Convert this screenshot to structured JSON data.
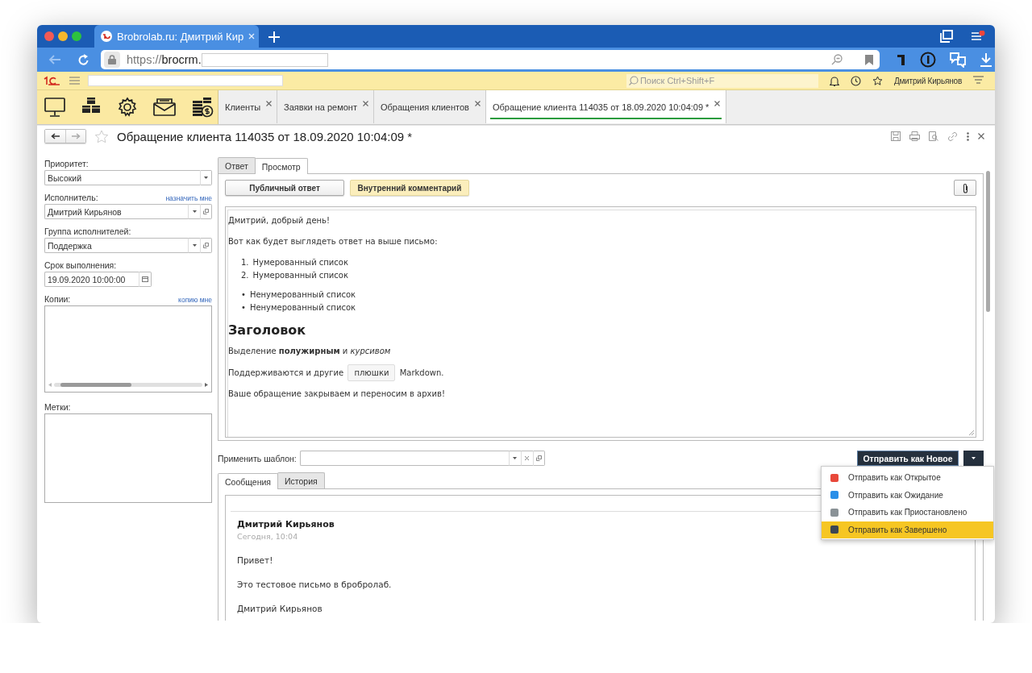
{
  "browser": {
    "tab_title": "Brobrolab.ru: Дмитрий Кир",
    "url_scheme": "https://",
    "url_host": "brocrm."
  },
  "app_header": {
    "search_placeholder": "Поиск Ctrl+Shift+F",
    "user_name": "Дмитрий Кирьянов"
  },
  "open_tabs": [
    {
      "label": "Клиенты",
      "selected": false
    },
    {
      "label": "Заявки на ремонт",
      "selected": false
    },
    {
      "label": "Обращения клиентов",
      "selected": false
    },
    {
      "label": "Обращение клиента 114035 от 18.09.2020 10:04:09 *",
      "selected": true
    }
  ],
  "form": {
    "title": "Обращение клиента 114035 от 18.09.2020 10:04:09 *"
  },
  "fields": [
    {
      "kind": "select",
      "label": "Приоритет:",
      "value": "Высокий"
    },
    {
      "kind": "reference",
      "label": "Исполнитель:",
      "link": "назначить мне",
      "value": "Дмитрий Кирьянов"
    },
    {
      "kind": "reference",
      "label": "Группа исполнителей:",
      "value": "Поддержка"
    },
    {
      "kind": "date",
      "label": "Срок выполнения:",
      "value": "19.09.2020 10:00:00"
    },
    {
      "kind": "list",
      "label": "Копии:",
      "link": "копию мне",
      "horizontal_scrollbar": true
    },
    {
      "kind": "list",
      "label": "Метки:",
      "horizontal_scrollbar": false
    }
  ],
  "editor_tabs": [
    {
      "label": "Ответ",
      "selected": false
    },
    {
      "label": "Просмотр",
      "selected": true
    }
  ],
  "reply_buttons": [
    {
      "kind": "public",
      "label": "Публичный ответ"
    },
    {
      "kind": "internal",
      "label": "Внутренний комментарий"
    }
  ],
  "preview": [
    {
      "kind": "paragraph",
      "text": "Дмитрий, добрый день!"
    },
    {
      "kind": "paragraph",
      "text": "Вот как будет выглядеть ответ на выше письмо:"
    },
    {
      "kind": "list",
      "items": [
        {
          "marker": "1.",
          "text": "Нумерованный список"
        },
        {
          "marker": "2.",
          "text": "Нумерованный список"
        }
      ]
    },
    {
      "kind": "list",
      "items": [
        {
          "marker": "•",
          "text": "Ненумерованный список"
        },
        {
          "marker": "•",
          "text": "Ненумерованный список"
        }
      ]
    },
    {
      "kind": "heading",
      "text": "Заголовок"
    },
    {
      "kind": "paragraph",
      "text": "Выделение **полужирным** и *курсивом*"
    },
    {
      "kind": "code_line",
      "before": "Поддерживаются и другие",
      "code": "плюшки",
      "after": "Markdown."
    },
    {
      "kind": "paragraph",
      "text": "Ваше обращение закрываем и переносим в архив!"
    }
  ],
  "template": {
    "label": "Применить шаблон:"
  },
  "send_button": {
    "label": "Отправить как Новое"
  },
  "send_menu": [
    {
      "label": "Отправить как Открытое",
      "color": "#e8483a",
      "selected": false
    },
    {
      "label": "Отправить как Ожидание",
      "color": "#2a8fe8",
      "selected": false
    },
    {
      "label": "Отправить как Приостановлено",
      "color": "#8a9296",
      "selected": false
    },
    {
      "label": "Отправить как Завершено",
      "color": "#3c4654",
      "selected": true
    }
  ],
  "message_tabs": [
    {
      "label": "Сообщения",
      "selected": true
    },
    {
      "label": "История",
      "selected": false
    }
  ],
  "messages": [
    {
      "author": "Дмитрий Кирьянов",
      "time": "Сегодня, 10:04",
      "paragraphs": [
        "Привет!",
        "Это тестовое письмо в бробролаб.",
        "Дмитрий Кирьянов"
      ]
    }
  ]
}
